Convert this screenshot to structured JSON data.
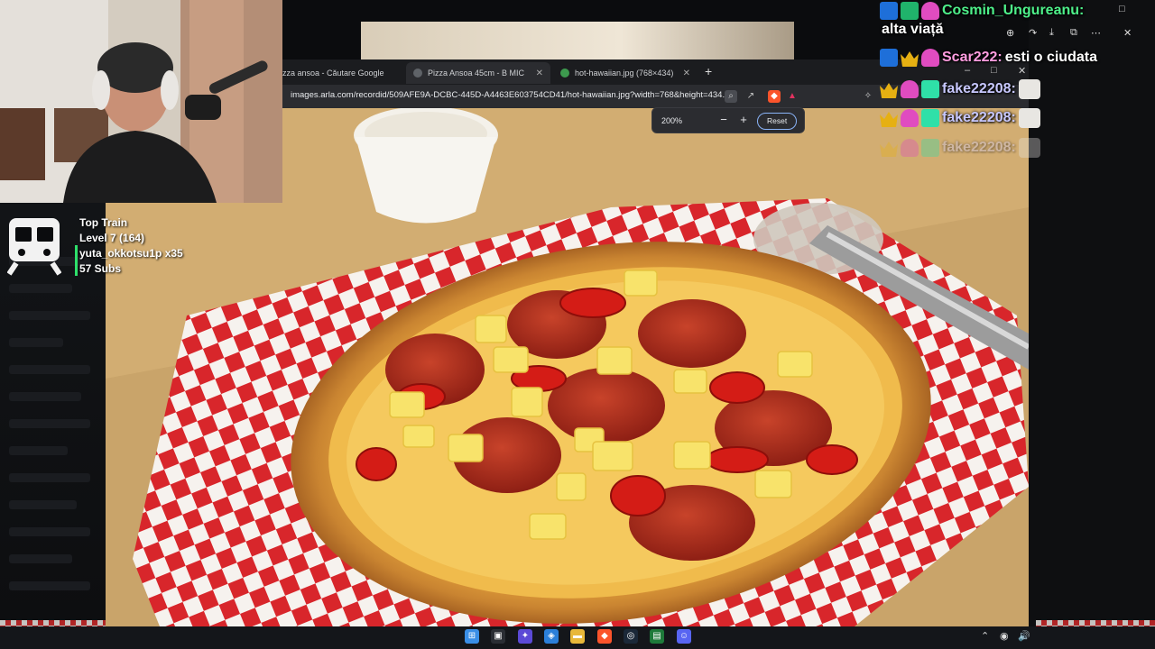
{
  "browser": {
    "tabs": [
      {
        "label": "izza ansoa - Căutare Google",
        "active": false
      },
      {
        "label": "Pizza Ansoa 45cm - B MIC",
        "active": true
      },
      {
        "label": "hot-hawaiian.jpg (768×434)",
        "active": false
      }
    ],
    "new_tab": "+",
    "minimize": "–",
    "maximize": "□",
    "close": "✕",
    "url": "images.arla.com/recordid/509AFE9A-DCBC-445D-A4463E603754CD41/hot-hawaiian.jpg?width=768&height=434..."
  },
  "zoom": {
    "level": "200%",
    "minus": "−",
    "plus": "+",
    "reset": "Reset"
  },
  "top_train": {
    "title": "Top Train",
    "level": "Level 7  (164)",
    "top_user": "yuta_okkotsu1p x35",
    "subs": "57 Subs"
  },
  "chat": {
    "messages": [
      {
        "user": "Cosmin_Ungureanu:",
        "user_color": "#4ef08a",
        "text": "alta viață",
        "badges": [
          "sword",
          "battery",
          "alien"
        ]
      },
      {
        "user": "Scar222:",
        "user_color": "#ff9de0",
        "text": "esti o ciudata",
        "badges": [
          "sword",
          "crown",
          "alien"
        ]
      },
      {
        "user": "fake22208:",
        "user_color": "#c8c8ff",
        "text": "",
        "badges": [
          "crown",
          "alien",
          "teal"
        ],
        "emote": "cat-emote"
      },
      {
        "user": "fake22208:",
        "user_color": "#c8c8ff",
        "text": "",
        "badges": [
          "crown",
          "alien",
          "teal"
        ],
        "emote": "cat-emote"
      },
      {
        "user": "fake22208:",
        "user_color": "#c8c8ff",
        "text": "",
        "badges": [
          "crown",
          "alien",
          "teal"
        ],
        "emote": "cat-emote"
      }
    ]
  },
  "colors": {
    "accent": "#8ab4f8",
    "train_bar": "#2ee06b",
    "checker_red": "#d92b2b"
  },
  "taskbar": {
    "icons": [
      "windows-icon",
      "task-view-icon",
      "copilot-icon",
      "widgets-icon",
      "explorer-icon",
      "brave-icon",
      "steam-icon",
      "terminal-icon",
      "discord-icon"
    ]
  }
}
